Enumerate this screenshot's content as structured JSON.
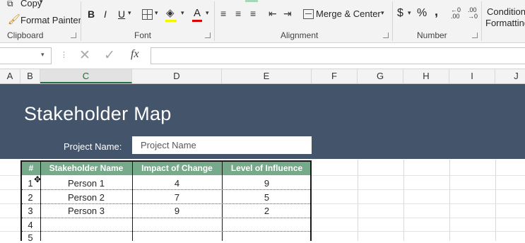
{
  "ribbon": {
    "clipboard": {
      "copy": "Copy",
      "format_painter": "Format Painter",
      "label": "Clipboard"
    },
    "font": {
      "label": "Font",
      "bold": "B",
      "italic": "I",
      "underline": "U",
      "font_color": "A"
    },
    "alignment": {
      "label": "Alignment",
      "merge_center": "Merge & Center"
    },
    "number": {
      "label": "Number",
      "currency": "$",
      "percent": "%",
      "comma": ",",
      "inc_decimal": "←0 .00",
      "dec_decimal": ".00 →0"
    },
    "styles": {
      "conditional": "Conditional",
      "formatting": "Formatting"
    }
  },
  "formula_bar": {
    "fx": "fx",
    "cancel": "✕",
    "enter": "✓",
    "name_value": "",
    "formula_value": ""
  },
  "columns": [
    "A",
    "B",
    "C",
    "D",
    "E",
    "F",
    "G",
    "H",
    "I",
    "J"
  ],
  "sheet": {
    "title": "Stakeholder Map",
    "project_label": "Project Name:",
    "project_value": "Project Name",
    "headers": [
      "#",
      "Stakeholder Name",
      "Impact of Change",
      "Level of Influence"
    ],
    "rows": [
      {
        "num": "1",
        "name": "Person 1",
        "impact": "4",
        "influence": "9"
      },
      {
        "num": "2",
        "name": "Person 2",
        "impact": "7",
        "influence": "5"
      },
      {
        "num": "3",
        "name": "Person 3",
        "impact": "9",
        "influence": "2"
      },
      {
        "num": "4",
        "name": "",
        "impact": "",
        "influence": ""
      },
      {
        "num": "5",
        "name": "",
        "impact": "",
        "influence": ""
      }
    ]
  },
  "colors": {
    "banner": "#44546a",
    "table_header": "#76aa8b",
    "accent": "#217346"
  }
}
